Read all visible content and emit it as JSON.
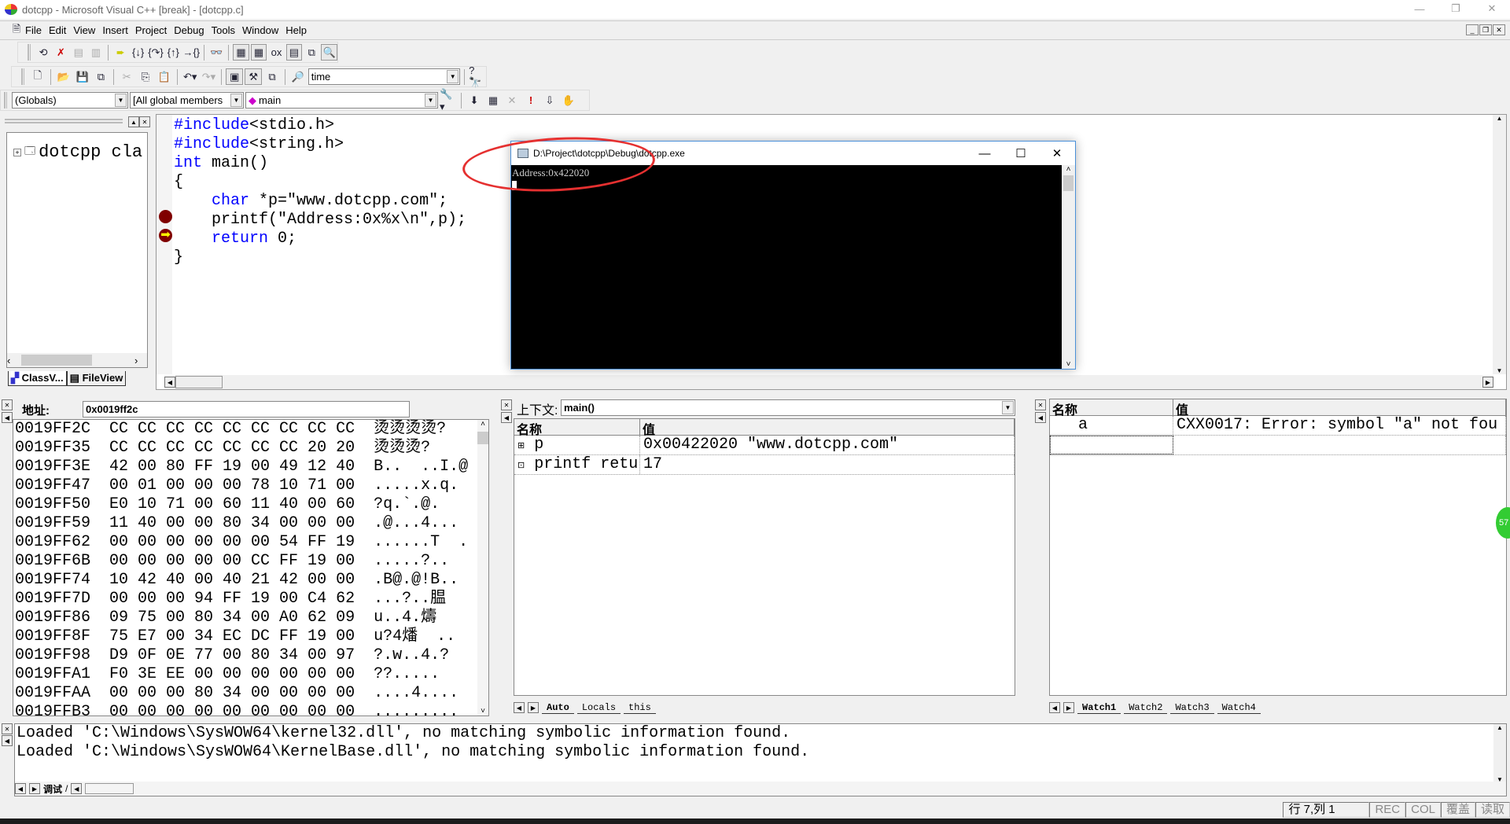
{
  "window": {
    "title": "dotcpp - Microsoft Visual C++ [break] - [dotcpp.c]"
  },
  "menu": [
    "File",
    "Edit",
    "View",
    "Insert",
    "Project",
    "Debug",
    "Tools",
    "Window",
    "Help"
  ],
  "toolbar": {
    "find_value": "time"
  },
  "wizardbar": {
    "scope": "(Globals)",
    "members": "[All global members",
    "function": "main"
  },
  "workspace": {
    "tree_root": "dotcpp cla",
    "tabs": [
      "ClassV...",
      "FileView"
    ]
  },
  "editor": {
    "lines": [
      [
        {
          "t": "#include",
          "k": 1
        },
        {
          "t": "<stdio.h>"
        }
      ],
      [
        {
          "t": "#include",
          "k": 1
        },
        {
          "t": "<string.h>"
        }
      ],
      [
        {
          "t": "int",
          "k": 1
        },
        {
          "t": " main()"
        }
      ],
      [
        {
          "t": "{"
        }
      ],
      [
        {
          "t": "    "
        },
        {
          "t": "char",
          "k": 1
        },
        {
          "t": " *p=\"www.dotcpp.com\";"
        }
      ],
      [
        {
          "t": "    printf(\"Address:0x%x\\n\",p);"
        }
      ],
      [
        {
          "t": "    "
        },
        {
          "t": "return",
          "k": 1
        },
        {
          "t": " 0;"
        }
      ],
      [
        {
          "t": "}"
        }
      ]
    ]
  },
  "console": {
    "title": "D:\\Project\\dotcpp\\Debug\\dotcpp.exe",
    "output": "Address:0x422020"
  },
  "memory": {
    "address_label": "地址:",
    "address_value": "0x0019ff2c",
    "rows": [
      "0019FF2C  CC CC CC CC CC CC CC CC CC  烫烫烫烫?",
      "0019FF35  CC CC CC CC CC CC CC 20 20  烫烫烫?",
      "0019FF3E  42 00 80 FF 19 00 49 12 40  B..  ..I.@",
      "0019FF47  00 01 00 00 00 78 10 71 00  .....x.q.",
      "0019FF50  E0 10 71 00 60 11 40 00 60  ?q.`.@.",
      "0019FF59  11 40 00 00 80 34 00 00 00  .@...4...",
      "0019FF62  00 00 00 00 00 00 54 FF 19  ......T  .",
      "0019FF6B  00 00 00 00 00 CC FF 19 00  .....?..",
      "0019FF74  10 42 40 00 40 21 42 00 00  .B@.@!B..",
      "0019FF7D  00 00 00 94 FF 19 00 C4 62  ...?..腽",
      "0019FF86  09 75 00 80 34 00 A0 62 09  u..4.燽",
      "0019FF8F  75 E7 00 34 EC DC FF 19 00  u?4燔  ..",
      "0019FF98  D9 0F 0E 77 00 80 34 00 97  ?.w..4.?",
      "0019FFA1  F0 3E EE 00 00 00 00 00 00  ??.....",
      "0019FFAA  00 00 00 80 34 00 00 00 00  ....4....",
      "0019FFB3  00 00 00 00 00 00 00 00 00  ........."
    ]
  },
  "variables": {
    "context_label": "上下文:",
    "context_value": "main()",
    "col_name": "名称",
    "col_value": "值",
    "rows": [
      {
        "name": "p",
        "value": "0x00422020 \"www.dotcpp.com\""
      },
      {
        "name": "printf retu",
        "value": "17"
      }
    ],
    "tabs": [
      "Auto",
      "Locals",
      "this"
    ]
  },
  "watch": {
    "col_name": "名称",
    "col_value": "值",
    "rows": [
      {
        "name": "a",
        "value": "CXX0017: Error: symbol \"a\" not fou"
      }
    ],
    "tabs": [
      "Watch1",
      "Watch2",
      "Watch3",
      "Watch4"
    ]
  },
  "output": {
    "lines": [
      "Loaded 'C:\\Windows\\SysWOW64\\kernel32.dll', no matching symbolic information found.",
      "Loaded 'C:\\Windows\\SysWOW64\\KernelBase.dll', no matching symbolic information found."
    ],
    "tab": "调试"
  },
  "status": {
    "position": "行 7,列 1",
    "rec": "REC",
    "col": "COL",
    "ovr": "覆盖",
    "read": "读取"
  },
  "colors": {
    "keyword": "#0000ff",
    "breakpoint": "#800000",
    "annotation": "#e53030"
  }
}
